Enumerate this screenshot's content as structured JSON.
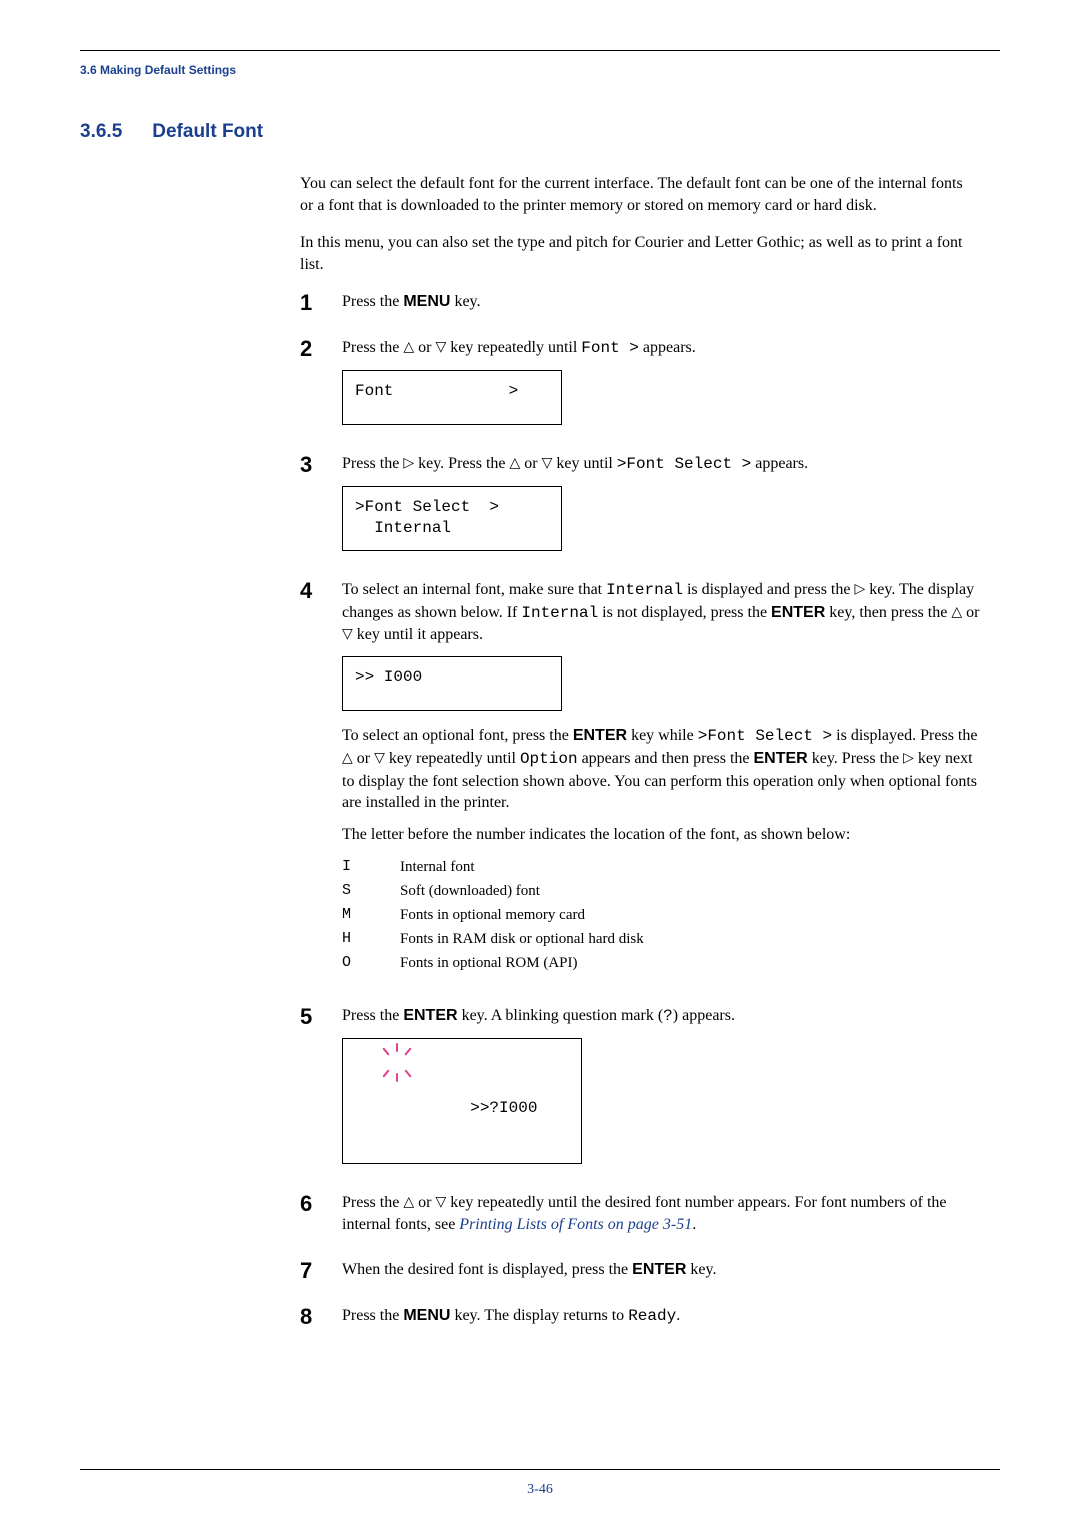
{
  "running_head": "3.6 Making Default Settings",
  "section_number": "3.6.5",
  "section_title": "Default Font",
  "intro_p1": "You can select the default font for the current interface. The default font can be one of the internal fonts or a font that is downloaded to the printer memory or stored on memory card or hard disk.",
  "intro_p2": "In this menu, you can also set the type and pitch for Courier and Letter Gothic; as well as to print a font list.",
  "glyph": {
    "up": "△",
    "down": "▽",
    "right": "▷"
  },
  "key": {
    "menu": "MENU",
    "enter": "ENTER"
  },
  "steps": {
    "s1": {
      "num": "1",
      "a": "Press the ",
      "b": " key."
    },
    "s2": {
      "num": "2",
      "a": "Press the ",
      "b": " or ",
      "c": " key repeatedly until ",
      "code": "Font >",
      "d": " appears.",
      "lcd": "Font            >"
    },
    "s3": {
      "num": "3",
      "a": "Press the ",
      "b": " key. Press the ",
      "c": " or ",
      "d": " key until ",
      "code": ">Font Select >",
      "e": " appears.",
      "lcd": ">Font Select  >\n  Internal"
    },
    "s4": {
      "num": "4",
      "p1a": "To select an internal font, make sure that ",
      "p1code1": "Internal",
      "p1b": " is displayed and press the ",
      "p1c": " key. The display changes as shown below. If ",
      "p1code2": "Internal",
      "p1d": " is not displayed, press the ",
      "p1e": " key, then press the ",
      "p1f": " or ",
      "p1g": " key until it appears.",
      "lcd": ">> I000",
      "p2a": "To select an optional font, press the ",
      "p2b": " key while ",
      "p2code1": ">Font Select >",
      "p2c": " is displayed. Press the ",
      "p2d": " or ",
      "p2e": " key repeatedly until ",
      "p2code2": "Option",
      "p2f": " appears and then press the ",
      "p2g": " key. Press the ",
      "p2h": " key next to display the font selection shown above. You can perform this operation only when optional fonts are installed in the printer.",
      "p3": "The letter before the number indicates the location of the font, as shown below:",
      "table": [
        {
          "c": "I",
          "d": "Internal font"
        },
        {
          "c": "S",
          "d": "Soft (downloaded) font"
        },
        {
          "c": "M",
          "d": "Fonts in optional memory card"
        },
        {
          "c": "H",
          "d": "Fonts in RAM disk or optional hard disk"
        },
        {
          "c": "O",
          "d": "Fonts in optional ROM (API)"
        }
      ]
    },
    "s5": {
      "num": "5",
      "a": "Press the ",
      "b": " key. A blinking question mark (",
      "q": "?",
      "c": ") appears.",
      "lcd": ">>?I000"
    },
    "s6": {
      "num": "6",
      "a": "Press the ",
      "b": " or ",
      "c": " key repeatedly until the desired font number appears. For font numbers of the internal fonts, see ",
      "link": "Printing Lists of Fonts on page 3-51",
      "d": "."
    },
    "s7": {
      "num": "7",
      "a": "When the desired font is displayed, press the ",
      "b": " key."
    },
    "s8": {
      "num": "8",
      "a": "Press the ",
      "b": " key. The display returns to ",
      "code": "Ready",
      "c": "."
    }
  },
  "page_number": "3-46"
}
